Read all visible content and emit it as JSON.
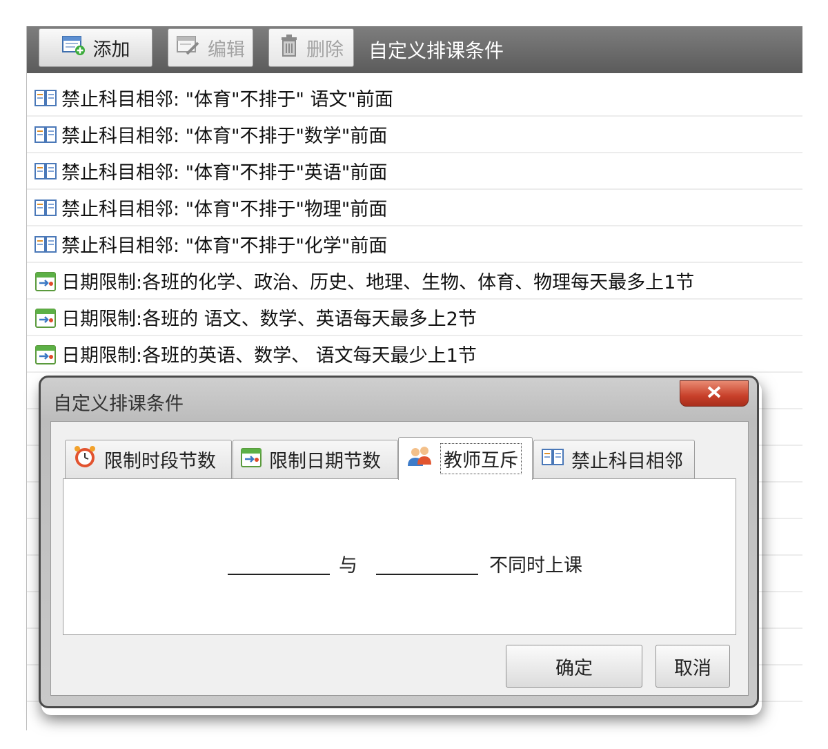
{
  "toolbar": {
    "add_label": "添加",
    "edit_label": "编辑",
    "delete_label": "删除",
    "title": "自定义排课条件"
  },
  "rows": [
    {
      "icon": "book-icon",
      "text": "禁止科目相邻: \"体育\"不排于\" 语文\"前面"
    },
    {
      "icon": "book-icon",
      "text": "禁止科目相邻: \"体育\"不排于\"数学\"前面"
    },
    {
      "icon": "book-icon",
      "text": "禁止科目相邻: \"体育\"不排于\"英语\"前面"
    },
    {
      "icon": "book-icon",
      "text": "禁止科目相邻: \"体育\"不排于\"物理\"前面"
    },
    {
      "icon": "book-icon",
      "text": "禁止科目相邻: \"体育\"不排于\"化学\"前面"
    },
    {
      "icon": "calendar-icon",
      "text": "日期限制:各班的化学、政治、历史、地理、生物、体育、物理每天最多上1节"
    },
    {
      "icon": "calendar-icon",
      "text": "日期限制:各班的 语文、数学、英语每天最多上2节"
    },
    {
      "icon": "calendar-icon",
      "text": "日期限制:各班的英语、数学、 语文每天最少上1节"
    }
  ],
  "dialog": {
    "title": "自定义排课条件",
    "tabs": [
      {
        "label": "限制时段节数",
        "icon": "alarm-clock-icon"
      },
      {
        "label": "限制日期节数",
        "icon": "calendar-icon"
      },
      {
        "label": "教师互斥",
        "icon": "teachers-icon"
      },
      {
        "label": "禁止科目相邻",
        "icon": "book-icon"
      }
    ],
    "active_tab": "教师互斥",
    "connector": "与",
    "suffix": "不同时上课",
    "ok_label": "确定",
    "cancel_label": "取消"
  },
  "colors": {
    "toolbar_bg": "#6b6b6b",
    "close_button": "#c8402a"
  }
}
